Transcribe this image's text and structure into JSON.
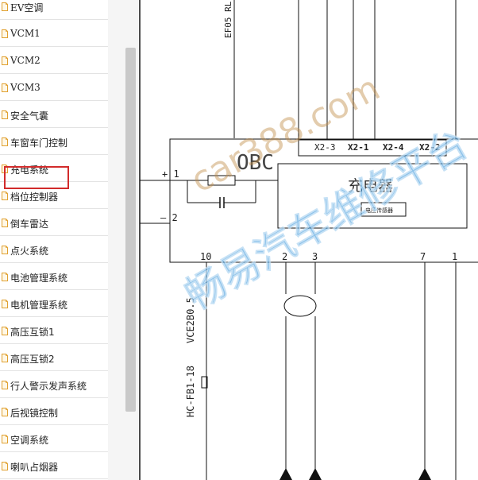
{
  "sidebar": {
    "items": [
      {
        "label": "EV空调"
      },
      {
        "label": "VCM1"
      },
      {
        "label": "VCM2"
      },
      {
        "label": "VCM3"
      },
      {
        "label": "安全气囊"
      },
      {
        "label": "车窗车门控制"
      },
      {
        "label": "充电系统",
        "selected": true
      },
      {
        "label": "档位控制器"
      },
      {
        "label": "倒车雷达"
      },
      {
        "label": "点火系统"
      },
      {
        "label": "电池管理系统"
      },
      {
        "label": "电机管理系统"
      },
      {
        "label": "高压互锁1"
      },
      {
        "label": "高压互锁2"
      },
      {
        "label": "行人警示发声系统"
      },
      {
        "label": "后视镜控制"
      },
      {
        "label": "空调系统"
      },
      {
        "label": "喇叭占烟器"
      }
    ],
    "selected_color": "#d22b2b",
    "icon": "document-icon"
  },
  "diagram": {
    "top_label": "EF05 RL",
    "connector_labels": [
      "X2-3",
      "X2-1",
      "X2-4",
      "X2-2"
    ],
    "obc_label": "OBC",
    "charger_label": "充电器",
    "small_box_label": "电压传感器",
    "plus_label": "+ 1",
    "minus_label": "– 2",
    "pin_labels": [
      "10",
      "2",
      "3",
      "7",
      "1"
    ],
    "wire_label_1": "VCE2B0.5",
    "wire_label_2": "HC-FB1-18"
  },
  "watermark": {
    "text1": "car388.com",
    "text2": "畅易汽车维修平台"
  }
}
